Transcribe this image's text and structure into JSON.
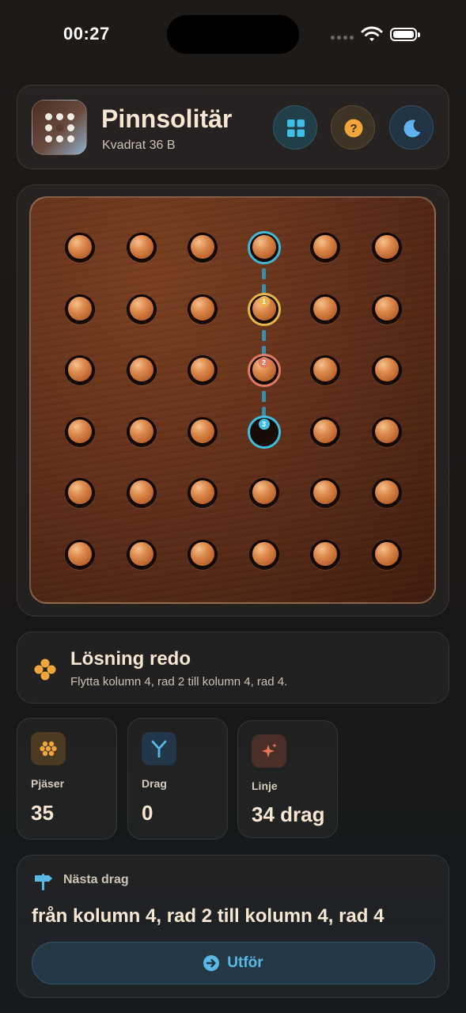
{
  "status_bar": {
    "time": "00:27"
  },
  "header": {
    "title": "Pinnsolitär",
    "subtitle": "Kvadrat 36 B",
    "buttons": [
      {
        "icon": "grid-icon",
        "color": "#3fc0e8"
      },
      {
        "icon": "help-icon",
        "glyph": "?",
        "color": "#f0a63a"
      },
      {
        "icon": "moon-icon",
        "color": "#5fb4ef"
      }
    ]
  },
  "board": {
    "rows": 6,
    "cols": 6,
    "empty": [
      [
        4,
        4
      ]
    ],
    "highlights": [
      {
        "col": 4,
        "row": 1,
        "color": "cyan"
      },
      {
        "col": 4,
        "row": 2,
        "color": "yellow",
        "badge": "1"
      },
      {
        "col": 4,
        "row": 3,
        "color": "red",
        "badge": "2"
      },
      {
        "col": 4,
        "row": 4,
        "color": "tblue",
        "badge": "3"
      }
    ]
  },
  "solution": {
    "title": "Lösning redo",
    "description": "Flytta kolumn 4, rad 2 till kolumn 4, rad 4."
  },
  "stats": [
    {
      "label": "Pjäser",
      "value": "35",
      "icon": "pegs-icon",
      "color": "#f0a63a"
    },
    {
      "label": "Drag",
      "value": "0",
      "icon": "branch-icon",
      "color": "#5ab8e6"
    },
    {
      "label": "Linje",
      "value": "34 drag",
      "icon": "sparkle-icon",
      "color": "#e8735a"
    }
  ],
  "next_move": {
    "label": "Nästa drag",
    "text": "från kolumn 4, rad 2 till kolumn 4, rad 4",
    "button_label": "Utför"
  },
  "colors": {
    "accent_cyan": "#41b8d8",
    "accent_yellow": "#e7b54a",
    "accent_red": "#e07a60",
    "peg": "#dd8a4d"
  }
}
